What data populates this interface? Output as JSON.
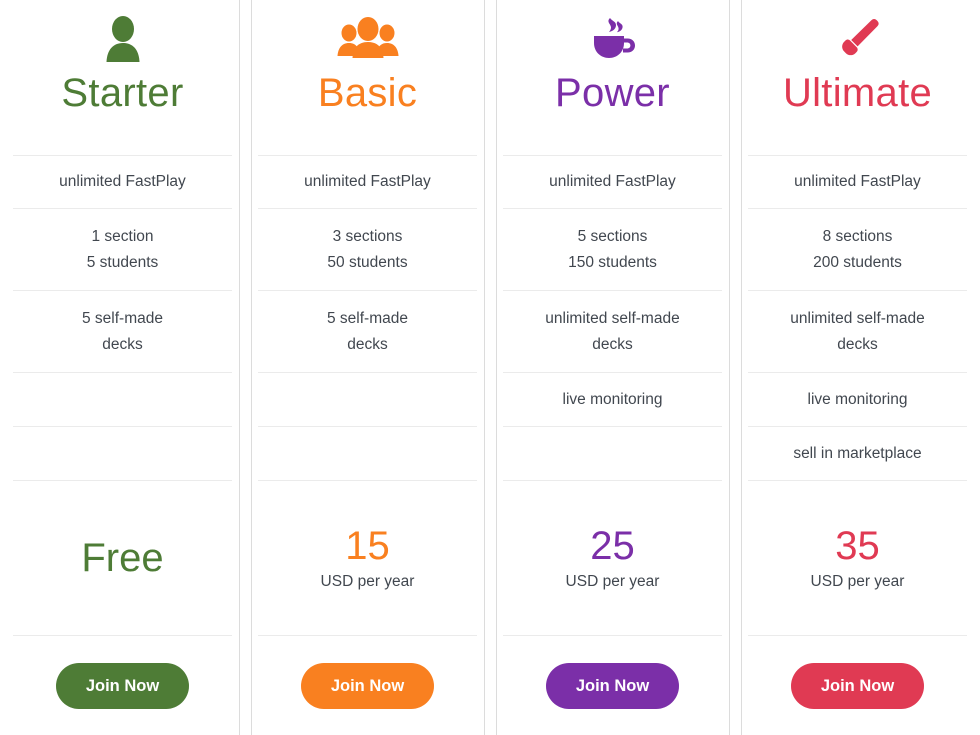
{
  "plans": [
    {
      "name": "Starter",
      "color": "#4e7c36",
      "icon": "single-user-icon",
      "features": [
        "unlimited FastPlay",
        "1 section\n5 students",
        "5 self-made\ndecks",
        "",
        ""
      ],
      "price": "Free",
      "price_unit": "",
      "cta_label": "Join Now"
    },
    {
      "name": "Basic",
      "color": "#f98020",
      "icon": "group-users-icon",
      "features": [
        "unlimited FastPlay",
        "3 sections\n50 students",
        "5 self-made\ndecks",
        "",
        ""
      ],
      "price": "15",
      "price_unit": "USD per year",
      "cta_label": "Join Now"
    },
    {
      "name": "Power",
      "color": "#7b2fa8",
      "icon": "coffee-cup-icon",
      "features": [
        "unlimited FastPlay",
        "5 sections\n150 students",
        "unlimited self-made\ndecks",
        "live monitoring",
        ""
      ],
      "price": "25",
      "price_unit": "USD per year",
      "cta_label": "Join Now"
    },
    {
      "name": "Ultimate",
      "color": "#e03a53",
      "icon": "paint-brush-icon",
      "features": [
        "unlimited FastPlay",
        "8 sections\n200 students",
        "unlimited self-made\ndecks",
        "live monitoring",
        "sell in marketplace"
      ],
      "price": "35",
      "price_unit": "USD per year",
      "cta_label": "Join Now"
    }
  ],
  "theme": {
    "divider_color": "#ebebeb",
    "column_divider_color": "#dcdcdc",
    "text_color": "#41474f",
    "background": "#ffffff"
  }
}
